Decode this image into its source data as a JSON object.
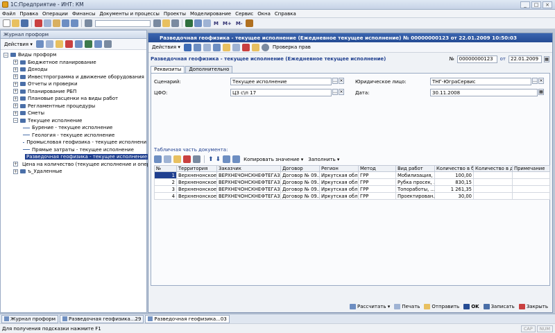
{
  "window": {
    "title": "1С:Предприятие - ИНТ: КМ",
    "buttons": [
      "_",
      "□",
      "×"
    ]
  },
  "menu": [
    "Файл",
    "Правка",
    "Операции",
    "Финансы",
    "Документы и процессы",
    "Проекты",
    "Моделирование",
    "Сервис",
    "Окна",
    "Справка"
  ],
  "toolbar": {
    "m_buttons": [
      "M",
      "M+",
      "M-"
    ]
  },
  "left_panel": {
    "title": "Журнал проформ",
    "actions_label": "Действия ▾",
    "tree": [
      {
        "label": "Виды проформ",
        "level": 0,
        "expander": "−"
      },
      {
        "label": "Бюджетное планирование",
        "level": 1,
        "expander": "+"
      },
      {
        "label": "Доходы",
        "level": 1,
        "expander": "+"
      },
      {
        "label": "Инвестпрограмма и движение оборудования",
        "level": 1,
        "expander": "+"
      },
      {
        "label": "Отчеты и проверки",
        "level": 1,
        "expander": "+"
      },
      {
        "label": "Планирование РБП",
        "level": 1,
        "expander": "+"
      },
      {
        "label": "Плановые расценки на виды работ",
        "level": 1,
        "expander": "+"
      },
      {
        "label": "Регламентные процедуры",
        "level": 1,
        "expander": "+"
      },
      {
        "label": "Сметы",
        "level": 1,
        "expander": "+"
      },
      {
        "label": "Текущее исполнение",
        "level": 1,
        "expander": "−"
      },
      {
        "label": "Бурение - текущее исполнение",
        "level": 2,
        "expander": ""
      },
      {
        "label": "Геология - текущее исполнение",
        "level": 2,
        "expander": ""
      },
      {
        "label": "Промысловая геофизика - текущее исполнени",
        "level": 2,
        "expander": ""
      },
      {
        "label": "Прямые затраты - текущее исполнение",
        "level": 2,
        "expander": ""
      },
      {
        "label": "Разведочная геофизика - текущее исполнение",
        "level": 2,
        "expander": "",
        "selected": true
      },
      {
        "label": "Цена на количество (текущее исполнение и операт",
        "level": 1,
        "expander": "+"
      },
      {
        "label": "ъ_Удаленные",
        "level": 1,
        "expander": "+"
      }
    ]
  },
  "doc": {
    "title": "Разведочная геофизика - текущее исполнение (Ежедневное текущее исполнение) № 00000000123 от 22.01.2009 10:50:03",
    "actions_label": "Действия ▾",
    "check_rights": "Проверка прав",
    "header": "Разведочная геофизика - текущее исполнение (Ежедневное текущее исполнение)",
    "number_label": "№",
    "number": "00000000123",
    "date_label": "от",
    "date": "22.01.2009",
    "tabs": [
      "Реквизиты",
      "Дополнительно"
    ],
    "fields": {
      "scenario_label": "Сценарий:",
      "scenario": "Текущее исполнение",
      "cfo_label": "ЦФО:",
      "cfo": "ЦЗ с\\п 17",
      "legal_label": "Юридическое лицо:",
      "legal": "ТНГ-ЮграСервис",
      "date_label": "Дата:",
      "date": "30.11.2008"
    },
    "tablepart_label": "Табличная часть документа:",
    "copy_value": "Копировать значение ▾",
    "fill": "Заполнить ▾",
    "columns": [
      "№",
      "Территория",
      "Заказчик",
      "Договор",
      "Регион",
      "Метод",
      "Вид работ",
      "Количество в б...",
      "Количество в д...",
      "Примечание"
    ],
    "rows": [
      [
        "1",
        "Верхненонское",
        "ВЕРХНЕЧОНСКНЕФТЕГАЗ",
        "Договор № 09...",
        "Иркутская обл...",
        "ГРР",
        "Мобилизация, %",
        "100,00",
        "",
        ""
      ],
      [
        "2",
        "Верхненонское",
        "ВЕРХНЕЧОНСКНЕФТЕГАЗ",
        "Договор № 09...",
        "Иркутская обл...",
        "ГРР",
        "Рубка просек, ...",
        "830,15",
        "",
        ""
      ],
      [
        "3",
        "Верхненонское",
        "ВЕРХНЕЧОНСКНЕФТЕГАЗ",
        "Договор № 09...",
        "Иркутская обл...",
        "ГРР",
        "Топоработы, ...",
        "1 261,35",
        "",
        ""
      ],
      [
        "4",
        "Верхненонское",
        "ВЕРХНЕЧОНСКНЕФТЕГАЗ",
        "Договор № 09...",
        "Иркутская обл...",
        "ГРР",
        "Проектирован...",
        "30,00",
        "",
        ""
      ]
    ],
    "bottom_buttons": {
      "calc": "Рассчитать ▾",
      "print": "Печать",
      "send": "Отправить",
      "ok": "OK",
      "save": "Записать",
      "close": "Закрыть"
    }
  },
  "taskbar": [
    {
      "label": "Журнал проформ",
      "active": false
    },
    {
      "label": "Разведочная геофизика...29",
      "active": false
    },
    {
      "label": "Разведочная геофизика...03",
      "active": true
    }
  ],
  "status": {
    "hint": "Для получения подсказки нажмите F1",
    "indicators": [
      "CAP",
      "NUM"
    ]
  },
  "colors": {
    "accent": "#254c94",
    "selection": "#1f3f8f",
    "background": "#bcc7d6"
  }
}
